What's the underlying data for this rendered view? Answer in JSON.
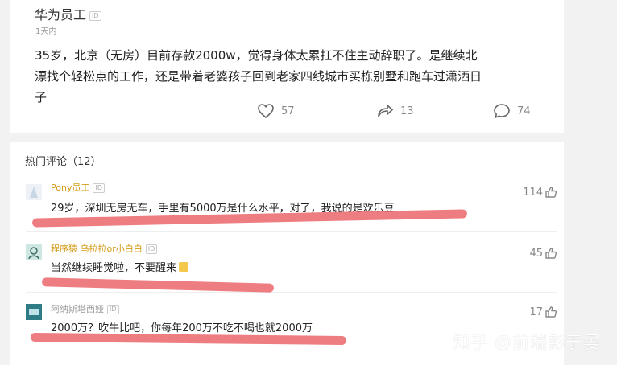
{
  "post": {
    "author": "华为员工",
    "id_badge": "ID",
    "time": "1天内",
    "body": "35岁，北京（无房）目前存款2000w，觉得身体太累扛不住主动辞职了。是继续北漂找个轻松点的工作，还是带着老婆孩子回到老家四线城市买栋别墅和跑车过潇洒日子",
    "likes": "57",
    "reposts": "13",
    "comments": "74"
  },
  "comments_section": {
    "title": "热门评论（12）",
    "items": [
      {
        "name": "Pony员工",
        "badge": "ID",
        "text": "29岁，深圳无房无车，手里有5000万是什么水平，对了，我说的是欢乐豆",
        "likes": "114"
      },
      {
        "name": "程序猿 乌拉拉or小白白",
        "badge": "ID",
        "text": "当然继续睡觉啦，不要醒来",
        "likes": "45"
      },
      {
        "name": "阿纳斯塔西娅",
        "badge": "ID",
        "text": "2000万？吹牛比吧，你每年200万不吃不喝也就2000万",
        "likes": "17"
      }
    ]
  },
  "watermark": "知乎 @前端彭于晏",
  "colors": {
    "highlight": "#ec6f73",
    "username": "#d39a14",
    "background": "#f2f2f2"
  }
}
